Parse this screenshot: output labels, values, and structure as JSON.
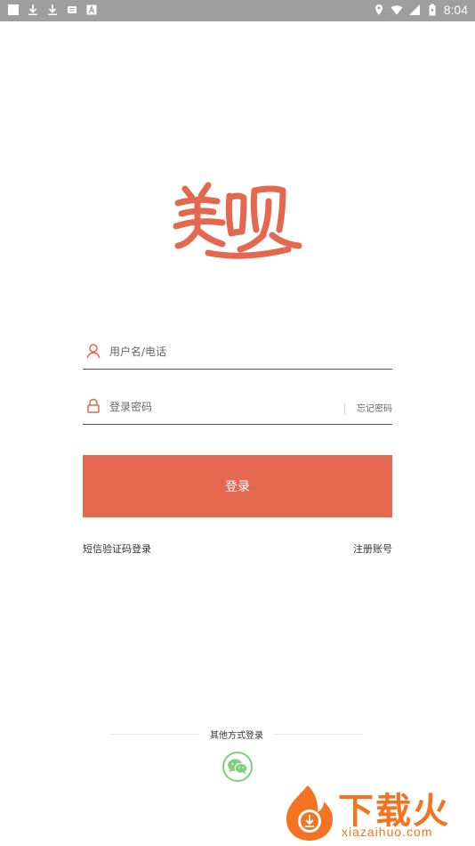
{
  "status_bar": {
    "time": "8:04",
    "left_icons": [
      "notification-square-icon",
      "download-icon",
      "download-icon",
      "storage-icon",
      "font-icon"
    ],
    "right_icons": [
      "location-icon",
      "wifi-icon",
      "signal-icon",
      "battery-icon"
    ]
  },
  "logo": {
    "text": "美呗",
    "color": "#e4674f"
  },
  "form": {
    "username_placeholder": "用户名/电话",
    "password_placeholder": "登录密码",
    "forgot_label": "忘记密码",
    "login_button": "登录",
    "sms_login": "短信验证码登录",
    "register": "注册账号"
  },
  "other_login": {
    "label": "其他方式登录",
    "options": [
      "wechat-icon"
    ]
  },
  "watermark": {
    "text": "下载火",
    "url": "xiazaihuo.com"
  },
  "colors": {
    "accent": "#e4674f",
    "wechat": "#7ed07a",
    "watermark": "#f47321"
  }
}
